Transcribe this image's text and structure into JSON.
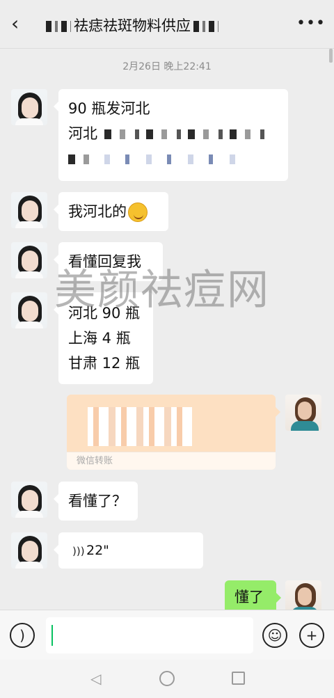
{
  "header": {
    "back_icon": "chevron-left-icon",
    "title": "祛痣祛斑物料供应",
    "more_icon": "more-icon"
  },
  "timestamp": "2月26日 晚上22:41",
  "messages": {
    "m1_line1": "90 瓶发河北",
    "m1_line2": "河北",
    "m2": "我河北的",
    "m3": "看懂回复我",
    "m4_line1": "河北 90 瓶",
    "m4_line2": "上海 4 瓶",
    "m4_line3": "甘肃 12 瓶",
    "transfer_label": "微信转账",
    "m5": "看懂了？",
    "voice_duration": "22\"",
    "m6": "懂了"
  },
  "watermark": "美颜祛痘网",
  "inputbar": {
    "voice_icon": "voice-icon",
    "emoji_icon": "emoji-icon",
    "plus_icon": "plus-icon"
  },
  "colors": {
    "background": "#ededed",
    "sent_bubble": "#95ec69",
    "transfer": "#fde0c2",
    "accent": "#07c160"
  }
}
